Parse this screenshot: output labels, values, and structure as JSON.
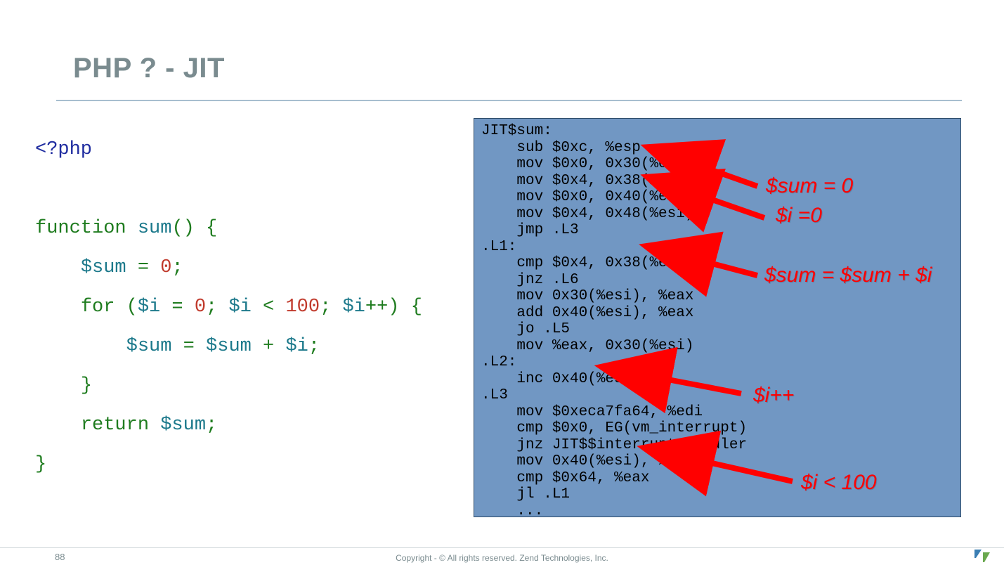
{
  "title": "PHP ? - JIT",
  "page_number": "88",
  "copyright": "Copyright - © All rights reserved. Zend Technologies, Inc.",
  "php": {
    "open_tag": "<?php",
    "fn_kw": "function",
    "fn_name": " sum",
    "fn_paren": "() {",
    "var_sum": "$sum",
    "var_i": "$i",
    "eq_sp": " = ",
    "zero": "0",
    "semi": ";",
    "for_kw": "for",
    "sp_open": " (",
    "lt_sp": " < ",
    "hundred": "100",
    "semi_sp": "; ",
    "pp_close": "++) {",
    "plus_sp": " + ",
    "close_br": "}",
    "return_kw": "return",
    "sp": " "
  },
  "asm": {
    "l0": "JIT$sum:",
    "l1": "    sub $0xc, %esp",
    "l2": "    mov $0x0, 0x30(%esi)",
    "l3": "    mov $0x4, 0x38(%esi)",
    "l4": "    mov $0x0, 0x40(%esi)",
    "l5": "    mov $0x4, 0x48(%esi)",
    "l6": "    jmp .L3",
    "l7": ".L1:",
    "l8": "    cmp $0x4, 0x38(%esi)",
    "l9": "    jnz .L6",
    "l10": "    mov 0x30(%esi), %eax",
    "l11": "    add 0x40(%esi), %eax",
    "l12": "    jo .L5",
    "l13": "    mov %eax, 0x30(%esi)",
    "l14": ".L2:",
    "l15": "    inc 0x40(%esi)",
    "l16": ".L3",
    "l17": "    mov $0xeca7fa64, %edi",
    "l18": "    cmp $0x0, EG(vm_interrupt)",
    "l19": "    jnz JIT$$interrupt_handler",
    "l20": "    mov 0x40(%esi), %eax",
    "l21": "    cmp $0x64, %eax",
    "l22": "    jl .L1",
    "l23": "    ..."
  },
  "annotations": {
    "a1": "$sum = 0",
    "a2": "$i =0",
    "a3": "$sum = $sum + $i",
    "a4": "$i++",
    "a5": "$i < 100"
  }
}
